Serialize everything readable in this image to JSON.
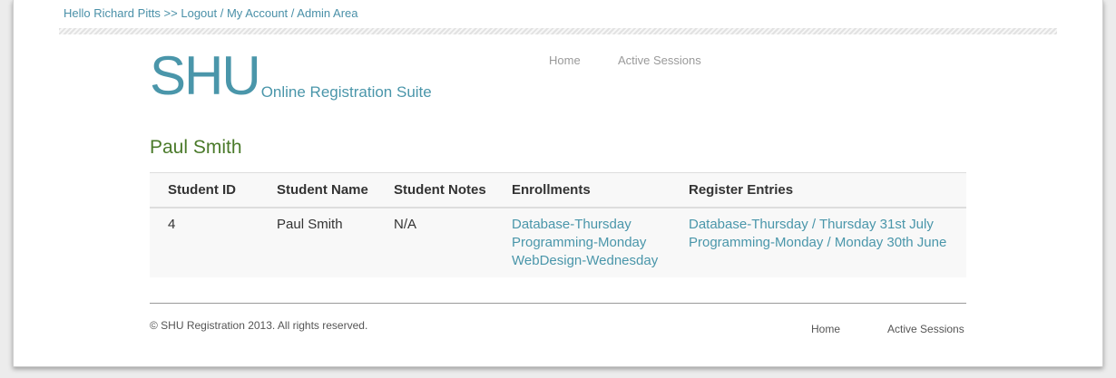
{
  "topbar": {
    "greeting": "Hello Richard Pitts >>",
    "logout": "Logout",
    "sep1": " / ",
    "account": "My Account",
    "sep2": " / ",
    "admin": "Admin Area"
  },
  "logo": {
    "big": "SHU",
    "small": "Online Registration Suite"
  },
  "nav": {
    "home": "Home",
    "active_sessions": "Active Sessions"
  },
  "page": {
    "title": "Paul Smith"
  },
  "table": {
    "headers": [
      "Student ID",
      "Student Name",
      "Student Notes",
      "Enrollments",
      "Register Entries"
    ],
    "row": {
      "id": "4",
      "name": "Paul Smith",
      "notes": "N/A",
      "enrollments": [
        "Database-Thursday",
        "Programming-Monday",
        "WebDesign-Wednesday"
      ],
      "register_entries": [
        "Database-Thursday / Thursday 31st July",
        "Programming-Monday / Monday 30th June"
      ]
    }
  },
  "footer": {
    "copyright": "© SHU Registration 2013. All rights reserved.",
    "home": "Home",
    "active_sessions": "Active Sessions"
  },
  "colors": {
    "link": "#4a90a8",
    "title": "#4a7a2a",
    "background": "#ececec"
  }
}
